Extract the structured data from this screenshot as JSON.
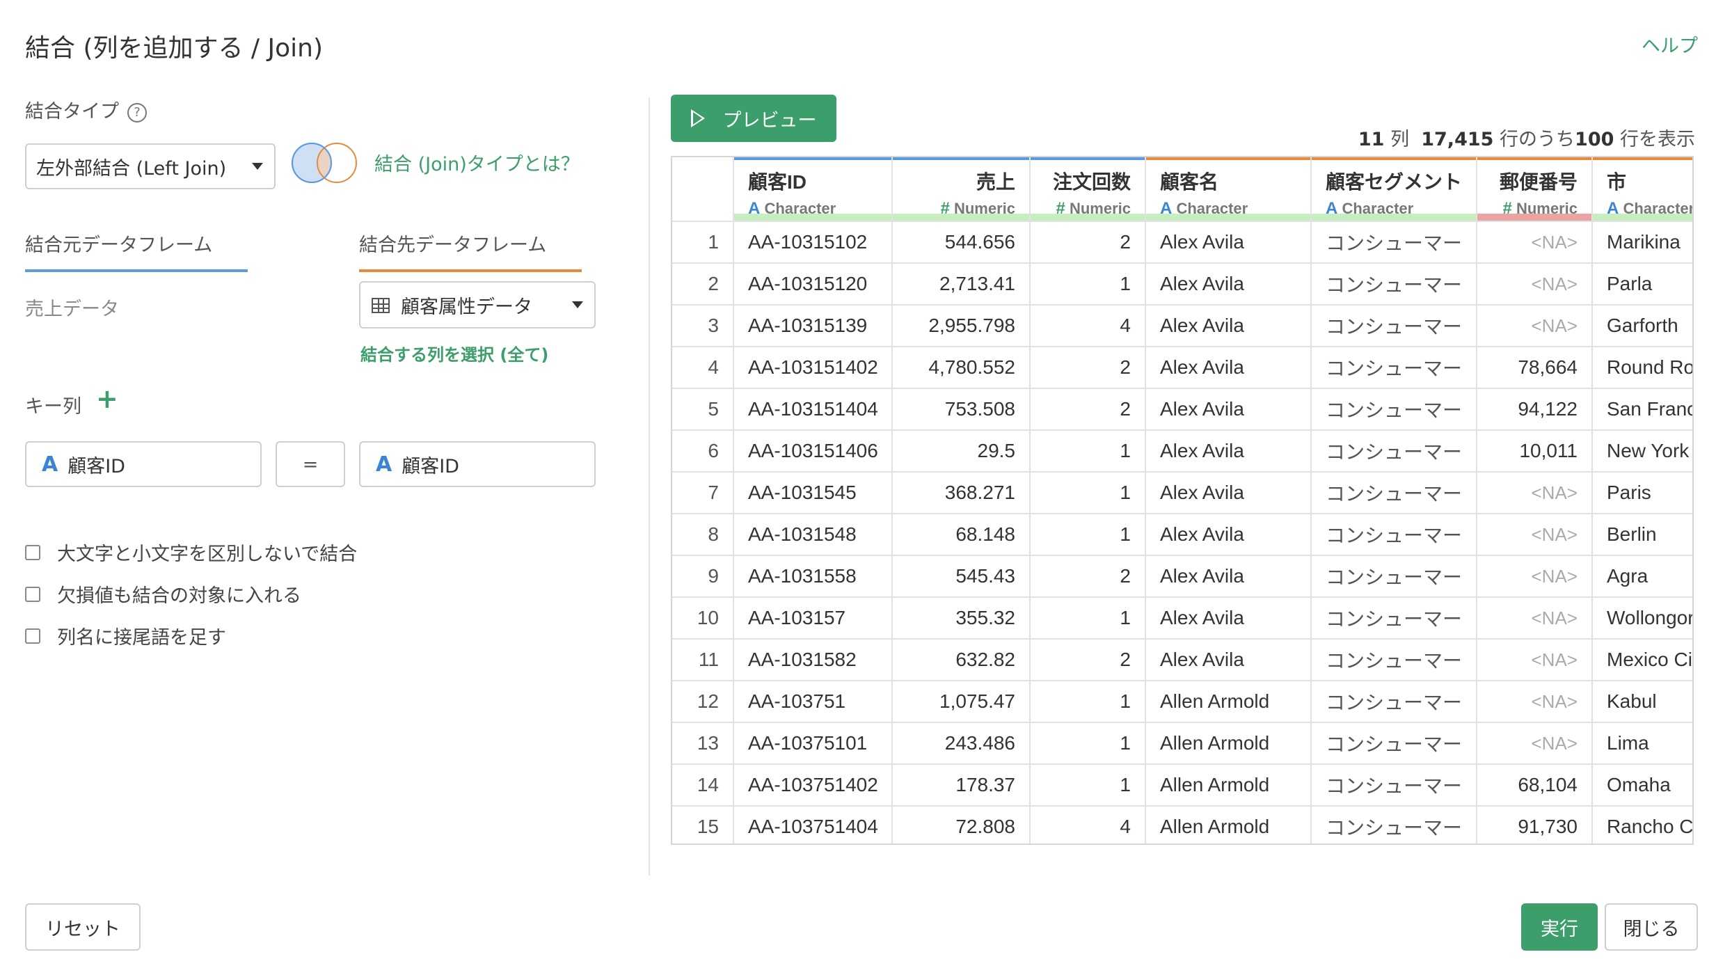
{
  "dialog": {
    "title": "結合 (列を追加する / Join)",
    "help_label": "ヘルプ"
  },
  "join_type": {
    "label": "結合タイプ",
    "help_icon_text": "?",
    "selected": "左外部結合 (Left Join)",
    "link_label": "結合 (Join)タイプとは？"
  },
  "tabs": {
    "source": "結合元データフレーム",
    "target": "結合先データフレーム"
  },
  "source_df": "売上データ",
  "target_df": {
    "selected": "顧客属性データ",
    "select_columns_link": "結合する列を選択 (全て)"
  },
  "keys": {
    "label": "キー列",
    "add_symbol": "+",
    "type_glyph": "A",
    "left": "顧客ID",
    "operator": "=",
    "right": "顧客ID"
  },
  "options": [
    {
      "label": "大文字と小文字を区別しないで結合",
      "checked": false
    },
    {
      "label": "欠損値も結合の対象に入れる",
      "checked": false
    },
    {
      "label": "列名に接尾語を足す",
      "checked": false
    }
  ],
  "footer": {
    "reset": "リセット",
    "run": "実行",
    "close": "閉じる"
  },
  "preview": {
    "button_label": "プレビュー",
    "summary": {
      "cols": "11",
      "cols_unit": "列",
      "total_rows": "17,415",
      "rows_mid": "行のうち",
      "shown_rows": "100",
      "rows_suffix": "行を表示"
    },
    "columns": [
      {
        "name": "顧客ID",
        "type_glyph": "A",
        "type": "Character",
        "align": "left",
        "top_color": "#5a9be0",
        "bottom": "green"
      },
      {
        "name": "売上",
        "type_glyph": "#",
        "type": "Numeric",
        "align": "right",
        "top_color": "#5a9be0",
        "bottom": "green"
      },
      {
        "name": "注文回数",
        "type_glyph": "#",
        "type": "Numeric",
        "align": "right",
        "top_color": "#5a9be0",
        "bottom": "green"
      },
      {
        "name": "顧客名",
        "type_glyph": "A",
        "type": "Character",
        "align": "left",
        "top_color": "#e68a3c",
        "bottom": "green"
      },
      {
        "name": "顧客セグメント",
        "type_glyph": "A",
        "type": "Character",
        "align": "left",
        "top_color": "#e68a3c",
        "bottom": "green"
      },
      {
        "name": "郵便番号",
        "type_glyph": "#",
        "type": "Numeric",
        "align": "right",
        "top_color": "#e68a3c",
        "bottom": "red"
      },
      {
        "name": "市",
        "type_glyph": "A",
        "type": "Character",
        "align": "left",
        "top_color": "#e68a3c",
        "bottom": "green"
      }
    ],
    "rows": [
      [
        "1",
        "AA-10315102",
        "544.656",
        "2",
        "Alex Avila",
        "コンシューマー",
        "<NA>",
        "Marikina"
      ],
      [
        "2",
        "AA-10315120",
        "2,713.41",
        "1",
        "Alex Avila",
        "コンシューマー",
        "<NA>",
        "Parla"
      ],
      [
        "3",
        "AA-10315139",
        "2,955.798",
        "4",
        "Alex Avila",
        "コンシューマー",
        "<NA>",
        "Garforth"
      ],
      [
        "4",
        "AA-103151402",
        "4,780.552",
        "2",
        "Alex Avila",
        "コンシューマー",
        "78,664",
        "Round Ro"
      ],
      [
        "5",
        "AA-103151404",
        "753.508",
        "2",
        "Alex Avila",
        "コンシューマー",
        "94,122",
        "San Franc"
      ],
      [
        "6",
        "AA-103151406",
        "29.5",
        "1",
        "Alex Avila",
        "コンシューマー",
        "10,011",
        "New York"
      ],
      [
        "7",
        "AA-1031545",
        "368.271",
        "1",
        "Alex Avila",
        "コンシューマー",
        "<NA>",
        "Paris"
      ],
      [
        "8",
        "AA-1031548",
        "68.148",
        "1",
        "Alex Avila",
        "コンシューマー",
        "<NA>",
        "Berlin"
      ],
      [
        "9",
        "AA-1031558",
        "545.43",
        "2",
        "Alex Avila",
        "コンシューマー",
        "<NA>",
        "Agra"
      ],
      [
        "10",
        "AA-103157",
        "355.32",
        "1",
        "Alex Avila",
        "コンシューマー",
        "<NA>",
        "Wollongor"
      ],
      [
        "11",
        "AA-1031582",
        "632.82",
        "2",
        "Alex Avila",
        "コンシューマー",
        "<NA>",
        "Mexico Ci"
      ],
      [
        "12",
        "AA-103751",
        "1,075.47",
        "1",
        "Allen Armold",
        "コンシューマー",
        "<NA>",
        "Kabul"
      ],
      [
        "13",
        "AA-10375101",
        "243.486",
        "1",
        "Allen Armold",
        "コンシューマー",
        "<NA>",
        "Lima"
      ],
      [
        "14",
        "AA-103751402",
        "178.37",
        "1",
        "Allen Armold",
        "コンシューマー",
        "68,104",
        "Omaha"
      ],
      [
        "15",
        "AA-103751404",
        "72.808",
        "4",
        "Allen Armold",
        "コンシューマー",
        "91,730",
        "Rancho C"
      ]
    ]
  }
}
